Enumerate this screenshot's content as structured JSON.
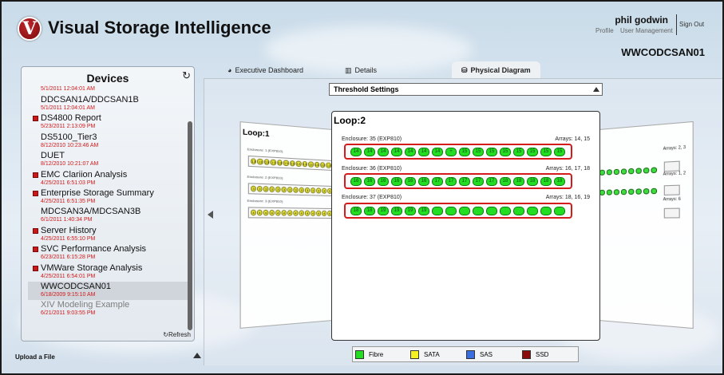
{
  "app": {
    "title": "Visual Storage Intelligence",
    "logo_letter": "V"
  },
  "user": {
    "name": "phil godwin",
    "profile": "Profile",
    "user_management": "User Management",
    "sign_out": "Sign Out"
  },
  "server_name": "WWCODCSAN01",
  "devices": {
    "title": "Devices",
    "refresh": "Refresh",
    "upload": "Upload a File",
    "items": [
      {
        "name": "",
        "date": "5/1/2011 12:04:01 AM",
        "icon": false,
        "partial": true
      },
      {
        "name": "DDCSAN1A/DDCSAN1B",
        "date": "5/1/2011 12:04:01 AM",
        "icon": false
      },
      {
        "name": "DS4800 Report",
        "date": "5/23/2011 2:13:09 PM",
        "icon": true
      },
      {
        "name": "DS5100_Tier3",
        "date": "8/12/2010 10:23:46 AM",
        "icon": false
      },
      {
        "name": "DUET",
        "date": "8/12/2010 10:21:07 AM",
        "icon": false
      },
      {
        "name": "EMC Clariion Analysis",
        "date": "4/25/2011 6:51:03 PM",
        "icon": true
      },
      {
        "name": "Enterprise Storage Summary",
        "date": "4/25/2011 6:51:35 PM",
        "icon": true
      },
      {
        "name": "MDCSAN3A/MDCSAN3B",
        "date": "6/1/2011 1:40:34 PM",
        "icon": false
      },
      {
        "name": "Server History",
        "date": "4/25/2011 6:55:10 PM",
        "icon": true
      },
      {
        "name": "SVC Performance Analysis",
        "date": "6/23/2011 6:15:28 PM",
        "icon": true
      },
      {
        "name": "VMWare Storage Analysis",
        "date": "4/25/2011 6:54:01 PM",
        "icon": true
      },
      {
        "name": "WWCODCSAN01",
        "date": "6/18/2009 9:15:10 AM",
        "icon": false,
        "selected": true
      },
      {
        "name": "XIV Modeling Example",
        "date": "6/21/2011 9:03:55 PM",
        "icon": false,
        "dim": true
      }
    ]
  },
  "tabs": [
    {
      "label": "Executive Dashboard",
      "icon": "gauge-icon"
    },
    {
      "label": "Details",
      "icon": "bar-chart-icon"
    },
    {
      "label": "Physical Diagram",
      "icon": "database-icon",
      "active": true
    }
  ],
  "threshold_label": "Threshold Settings",
  "loop_main": {
    "title": "Loop:2",
    "enclosures": [
      {
        "label": "Enclosure: 35 (EXP810)",
        "arrays": "Arrays: 14, 15",
        "disks": [
          "14",
          "14",
          "14",
          "14",
          "14",
          "14",
          "14",
          "+",
          "15",
          "15",
          "15",
          "15",
          "15",
          "15",
          "15",
          "15"
        ]
      },
      {
        "label": "Enclosure: 36 (EXP810)",
        "arrays": "Arrays: 16, 17, 18",
        "disks": [
          "16",
          "16",
          "16",
          "16",
          "16",
          "16",
          "17",
          "17",
          "17",
          "17",
          "17",
          "18",
          "18",
          "18",
          "18",
          "18"
        ]
      },
      {
        "label": "Enclosure: 37 (EXP810)",
        "arrays": "Arrays: 18, 16, 19",
        "disks": [
          "18",
          "18",
          "19",
          "19",
          "19",
          "19",
          "",
          "",
          "",
          "",
          "",
          "",
          "",
          "",
          "",
          ""
        ]
      }
    ]
  },
  "loop_left": {
    "title": "Loop:1",
    "enclosures": [
      {
        "label": "Enclosure: 1 (EXP810)",
        "disks": [
          "13",
          "13",
          "13",
          "13",
          "13",
          "13",
          "13",
          "13",
          "13",
          "13",
          "13",
          "13",
          "13",
          "13",
          "13",
          "13"
        ]
      },
      {
        "label": "Enclosure: 2 (EXP810)",
        "disks": [
          "3",
          "3",
          "3",
          "3",
          "3",
          "3",
          "3",
          "3",
          "3",
          "3",
          "3",
          "3",
          "3",
          "3",
          "3",
          "3"
        ]
      },
      {
        "label": "Enclosure: 3 (EXP810)",
        "disks": [
          "4",
          "4",
          "4",
          "4",
          "4",
          "4",
          "4",
          "4",
          "4",
          "4",
          "4",
          "4",
          "4",
          "4",
          "4",
          "4"
        ]
      }
    ]
  },
  "loop_right": {
    "arrays": [
      "Arrays: 2, 3",
      "Arrays: 1, 2",
      "Arrays: 6"
    ]
  },
  "legend": [
    {
      "label": "Fibre",
      "color": "#22dd22"
    },
    {
      "label": "SATA",
      "color": "#f5f020"
    },
    {
      "label": "SAS",
      "color": "#3a6ee0"
    },
    {
      "label": "SSD",
      "color": "#8b0a0a"
    }
  ]
}
